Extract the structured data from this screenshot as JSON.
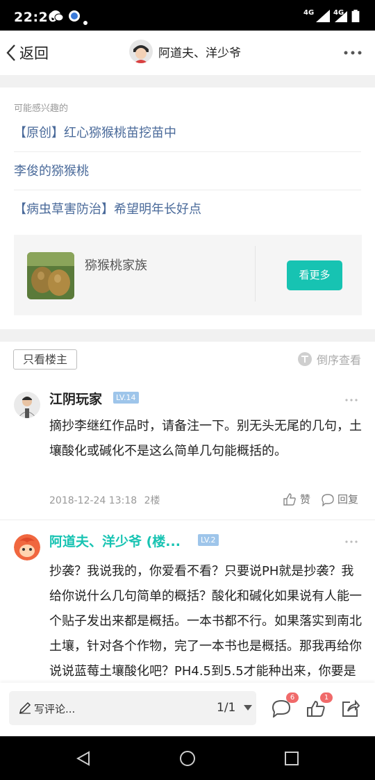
{
  "status_bar": {
    "time": "22:26",
    "net_left": "4G",
    "net_right": "4G"
  },
  "nav": {
    "back_label": "返回",
    "title": "阿道夫、洋少爷"
  },
  "interest": {
    "title": "可能感兴趣的",
    "links": [
      "【原创】红心猕猴桃苗挖苗中",
      "李俊的猕猴桃",
      "【病虫草害防治】希望明年长好点"
    ],
    "card": {
      "name": "猕猴桃家族",
      "button": "看更多"
    }
  },
  "filter": {
    "only_op": "只看楼主",
    "reverse": "倒序查看"
  },
  "posts": [
    {
      "author": "江阴玩家",
      "level": "LV.14",
      "body": "摘抄李继红作品时，请备注一下。别无头无尾的几句，土壤酸化或碱化不是这么简单几句能概括的。",
      "time": "2018-12-24 13:18",
      "floor": "2楼",
      "like": "赞",
      "reply": "回复"
    },
    {
      "author": "阿道夫、洋少爷 (楼...",
      "level": "LV.2",
      "body": "抄袭？我说我的，你爱看不看？只要说PH就是抄袭？我给你说什么几句简单的概括？酸化和碱化如果说有人能一个贴子发出来都是概括。一本书都不行。如果落实到南北土壤，针对各个作物，完了一本书也是概括。那我再给你说说蓝莓土壤酸化吧？PH4.5到5.5才能种出来，你要是懂这个"
    }
  ],
  "bottom": {
    "comment_placeholder": "写评论...",
    "pager": "1/1",
    "comment_badge": "6",
    "like_badge": "1"
  },
  "colors": {
    "accent": "#17c3b2",
    "link": "#4a6a9a",
    "level_badge": "#9ec5ea",
    "badge": "#f06a6a"
  }
}
